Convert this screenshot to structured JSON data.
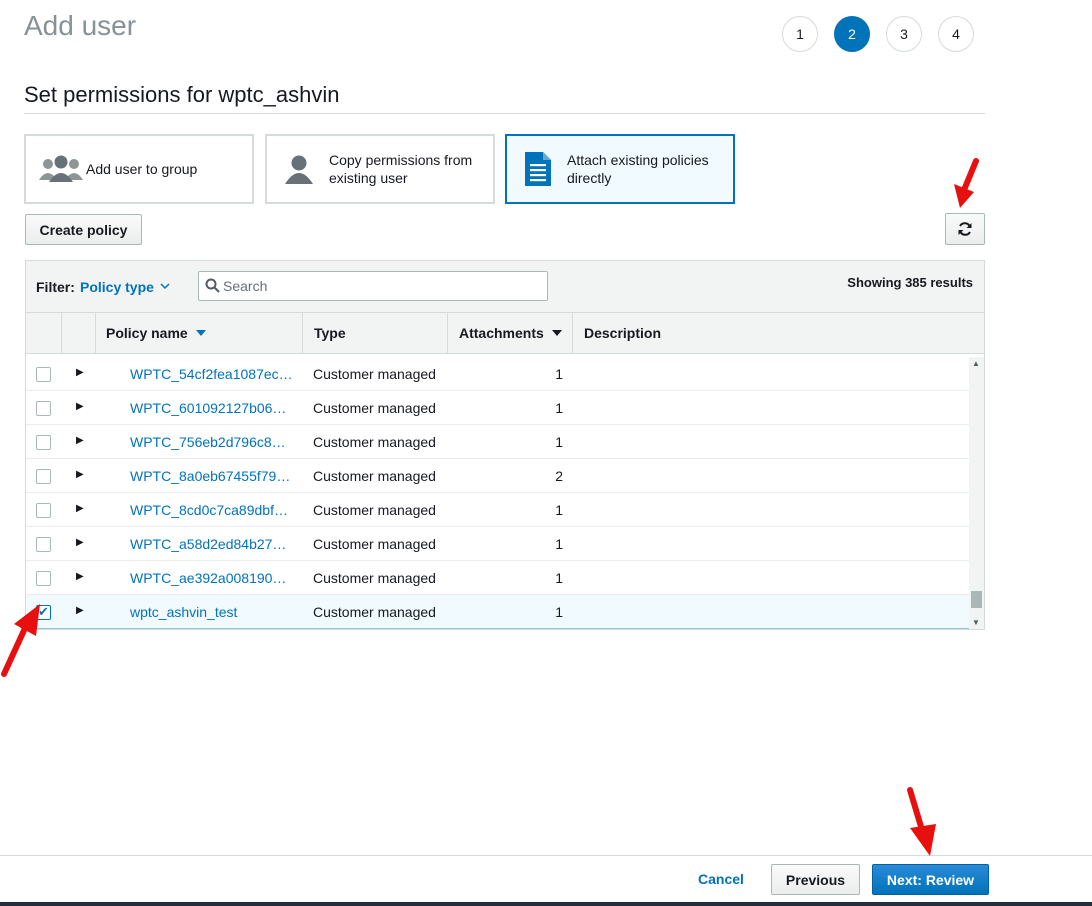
{
  "header": {
    "title": "Add user",
    "steps": [
      {
        "label": "1",
        "active": false
      },
      {
        "label": "2",
        "active": true
      },
      {
        "label": "3",
        "active": false
      },
      {
        "label": "4",
        "active": false
      }
    ]
  },
  "section": {
    "title": "Set permissions for wptc_ashvin"
  },
  "options": {
    "add_to_group": "Add user to group",
    "copy_permissions": "Copy permissions from existing user",
    "attach_policies": "Attach existing policies directly",
    "selected": "attach_policies"
  },
  "toolbar": {
    "create_policy": "Create policy",
    "refresh_icon": "refresh-icon"
  },
  "filter": {
    "label": "Filter:",
    "value": "Policy type",
    "search_placeholder": "Search",
    "results": "Showing 385 results"
  },
  "table": {
    "columns": {
      "policy_name": "Policy name",
      "type": "Type",
      "attachments": "Attachments",
      "description": "Description"
    },
    "rows": [
      {
        "name": "WPTC_54cf2fea1087ec…",
        "type": "Customer managed",
        "attachments": "1",
        "description": "",
        "checked": false
      },
      {
        "name": "WPTC_601092127b06…",
        "type": "Customer managed",
        "attachments": "1",
        "description": "",
        "checked": false
      },
      {
        "name": "WPTC_756eb2d796c8…",
        "type": "Customer managed",
        "attachments": "1",
        "description": "",
        "checked": false
      },
      {
        "name": "WPTC_8a0eb67455f79…",
        "type": "Customer managed",
        "attachments": "2",
        "description": "",
        "checked": false
      },
      {
        "name": "WPTC_8cd0c7ca89dbf…",
        "type": "Customer managed",
        "attachments": "1",
        "description": "",
        "checked": false
      },
      {
        "name": "WPTC_a58d2ed84b27…",
        "type": "Customer managed",
        "attachments": "1",
        "description": "",
        "checked": false
      },
      {
        "name": "WPTC_ae392a008190…",
        "type": "Customer managed",
        "attachments": "1",
        "description": "",
        "checked": false
      },
      {
        "name": "wptc_ashvin_test",
        "type": "Customer managed",
        "attachments": "1",
        "description": "",
        "checked": true
      }
    ]
  },
  "footer": {
    "cancel": "Cancel",
    "previous": "Previous",
    "next": "Next: Review"
  },
  "colors": {
    "accent": "#0073bb",
    "annotation": "#e8100e"
  }
}
